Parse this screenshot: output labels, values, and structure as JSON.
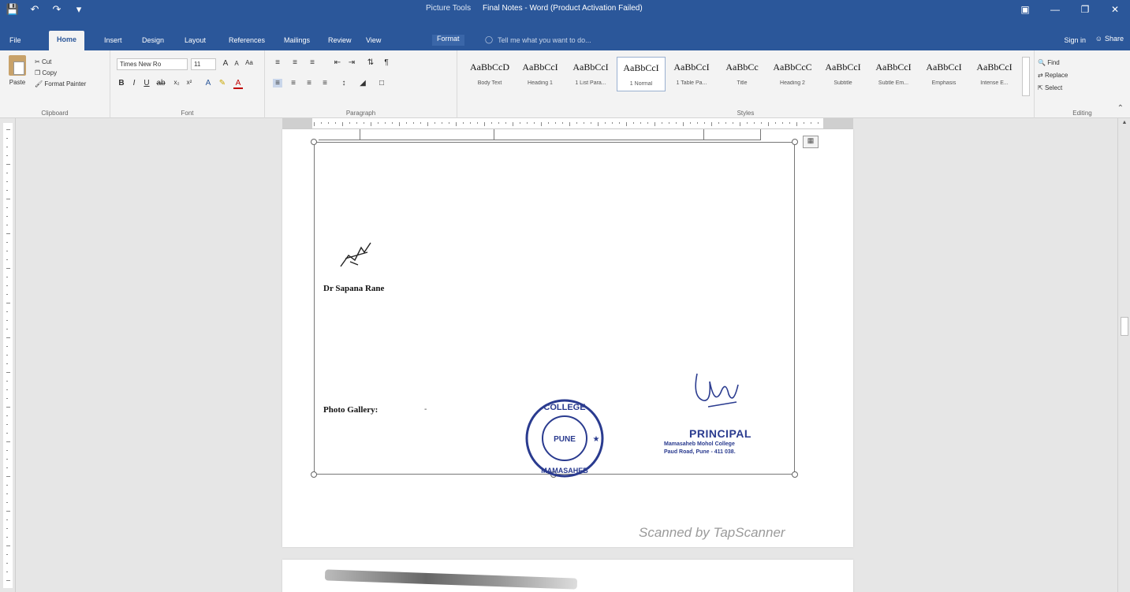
{
  "titlebar": {
    "context_label": "Picture Tools",
    "document_title": "Final Notes - Word (Product Activation Failed)",
    "window_buttons": [
      "ribbon-options-icon",
      "minimize-icon",
      "restore-icon",
      "close-icon"
    ]
  },
  "tabs": [
    "File",
    "Home",
    "Insert",
    "Design",
    "Layout",
    "References",
    "Mailings",
    "Review",
    "View",
    "Format"
  ],
  "active_tab": "Home",
  "tell_me": "Tell me what you want to do...",
  "sign_in": "Sign in",
  "share": "Share",
  "ribbon": {
    "clipboard": {
      "paste": "Paste",
      "cut": "Cut",
      "copy": "Copy",
      "format_painter": "Format Painter",
      "label": "Clipboard"
    },
    "font": {
      "name": "Times New Ro",
      "size": "11",
      "label": "Font"
    },
    "paragraph": {
      "label": "Paragraph"
    },
    "styles": {
      "label": "Styles",
      "items": [
        {
          "sample": "AaBbCcD",
          "name": "Body Text"
        },
        {
          "sample": "AaBbCcI",
          "name": "Heading 1"
        },
        {
          "sample": "AaBbCcI",
          "name": "1 List Para..."
        },
        {
          "sample": "AaBbCcI",
          "name": "1 Normal"
        },
        {
          "sample": "AaBbCcI",
          "name": "1 Table Pa..."
        },
        {
          "sample": "AaBbCc",
          "name": "Title"
        },
        {
          "sample": "AaBbCcC",
          "name": "Heading 2"
        },
        {
          "sample": "AaBbCcI",
          "name": "Subtitle"
        },
        {
          "sample": "AaBbCcI",
          "name": "Subtle Em..."
        },
        {
          "sample": "AaBbCcI",
          "name": "Emphasis"
        },
        {
          "sample": "AaBbCcI",
          "name": "Intense E..."
        }
      ],
      "selected_index": 3
    },
    "editing": {
      "find": "Find",
      "replace": "Replace",
      "select": "Select",
      "label": "Editing"
    }
  },
  "document": {
    "signatory_name": "Dr Sapana Rane",
    "photo_gallery_label": "Photo Gallery:",
    "dash_mark": "-",
    "principal_title": "PRINCIPAL",
    "college_name": "Mamasaheb Mohol College",
    "address": "Paud Road, Pune - 411 038.",
    "stamp_text_top": "COLLEGE",
    "stamp_text_bottom": "MAMASAHEB",
    "stamp_text_middle": "PUNE",
    "watermark": "Scanned by TapScanner"
  },
  "colors": {
    "brand_blue": "#2b579a",
    "stamp_blue": "#2a3b8f"
  }
}
